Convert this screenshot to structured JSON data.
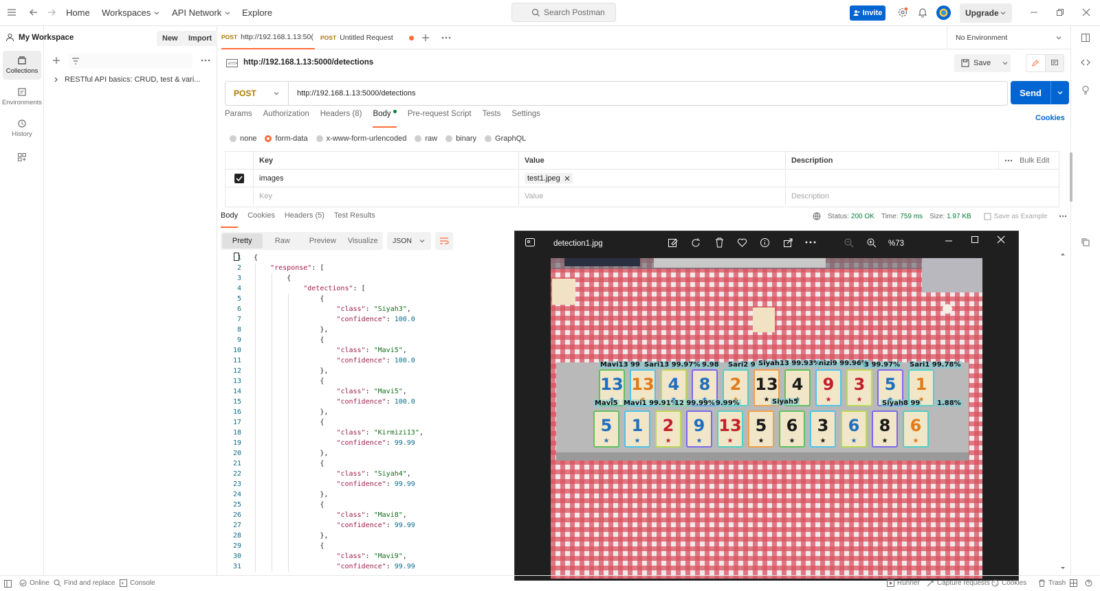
{
  "topbar": {
    "home": "Home",
    "workspaces": "Workspaces",
    "api_network": "API Network",
    "explore": "Explore",
    "search_placeholder": "Search Postman",
    "invite": "Invite",
    "upgrade": "Upgrade"
  },
  "rail": {
    "collections": "Collections",
    "environments": "Environments",
    "history": "History"
  },
  "sidebar": {
    "workspace": "My Workspace",
    "new": "New",
    "import": "Import",
    "collection_item": "RESTful API basics: CRUD, test & vari..."
  },
  "tabs": [
    {
      "method": "POST",
      "label": "http://192.168.1.13:50("
    },
    {
      "method": "POST",
      "label": "Untitled Request"
    }
  ],
  "environment": "No Environment",
  "request": {
    "breadcrumb_url": "http://192.168.1.13:5000/detections",
    "save": "Save",
    "method": "POST",
    "url": "http://192.168.1.13:5000/detections",
    "send": "Send",
    "cookies": "Cookies",
    "subtabs": [
      "Params",
      "Authorization",
      "Headers (8)",
      "Body",
      "Pre-request Script",
      "Tests",
      "Settings"
    ],
    "body_types": [
      "none",
      "form-data",
      "x-www-form-urlencoded",
      "raw",
      "binary",
      "GraphQL"
    ]
  },
  "params_table": {
    "headers": {
      "key": "Key",
      "value": "Value",
      "description": "Description",
      "bulk_edit": "Bulk Edit"
    },
    "row": {
      "key": "images",
      "value": "test1.jpeg"
    },
    "placeholder": {
      "key": "Key",
      "value": "Value",
      "description": "Description"
    }
  },
  "response": {
    "tabs": [
      "Body",
      "Cookies",
      "Headers (5)",
      "Test Results"
    ],
    "status_label": "Status:",
    "status_value": "200 OK",
    "time_label": "Time:",
    "time_value": "759 ms",
    "size_label": "Size:",
    "size_value": "1.97 KB",
    "save_example": "Save as Example",
    "views": [
      "Pretty",
      "Raw",
      "Preview",
      "Visualize"
    ],
    "format": "JSON"
  },
  "code_lines": [
    {
      "n": "1",
      "t": "{"
    },
    {
      "n": "2",
      "t": "    \"response\": ["
    },
    {
      "n": "3",
      "t": "        {"
    },
    {
      "n": "4",
      "t": "            \"detections\": ["
    },
    {
      "n": "5",
      "t": "                {"
    },
    {
      "n": "6",
      "t": "                    \"class\": \"Siyah3\","
    },
    {
      "n": "7",
      "t": "                    \"confidence\": 100.0"
    },
    {
      "n": "8",
      "t": "                },"
    },
    {
      "n": "9",
      "t": "                {"
    },
    {
      "n": "10",
      "t": "                    \"class\": \"Mavi5\","
    },
    {
      "n": "11",
      "t": "                    \"confidence\": 100.0"
    },
    {
      "n": "12",
      "t": "                },"
    },
    {
      "n": "13",
      "t": "                {"
    },
    {
      "n": "14",
      "t": "                    \"class\": \"Mavi5\","
    },
    {
      "n": "15",
      "t": "                    \"confidence\": 100.0"
    },
    {
      "n": "16",
      "t": "                },"
    },
    {
      "n": "17",
      "t": "                {"
    },
    {
      "n": "18",
      "t": "                    \"class\": \"Kirmizi13\","
    },
    {
      "n": "19",
      "t": "                    \"confidence\": 99.99"
    },
    {
      "n": "20",
      "t": "                },"
    },
    {
      "n": "21",
      "t": "                {"
    },
    {
      "n": "22",
      "t": "                    \"class\": \"Siyah4\","
    },
    {
      "n": "23",
      "t": "                    \"confidence\": 99.99"
    },
    {
      "n": "24",
      "t": "                },"
    },
    {
      "n": "25",
      "t": "                {"
    },
    {
      "n": "26",
      "t": "                    \"class\": \"Mavi8\","
    },
    {
      "n": "27",
      "t": "                    \"confidence\": 99.99"
    },
    {
      "n": "28",
      "t": "                },"
    },
    {
      "n": "29",
      "t": "                {"
    },
    {
      "n": "30",
      "t": "                    \"class\": \"Mavi9\","
    },
    {
      "n": "31",
      "t": "                    \"confidence\": 99.99"
    }
  ],
  "viewer": {
    "filename": "detection1.jpg",
    "zoom": "%73",
    "detection_labels": [
      "Mavi13 99",
      "Sari13 99.97%",
      "9.98",
      "Sari2 9",
      "Siyah13 99.93%",
      "nizi9 99.96%",
      "3 99.97%",
      "Sari1 99.78%",
      "Mavi5",
      "Mavi1 99.91%",
      "12 99.99%",
      "9.99%",
      "Siyah5",
      "Siyah8 99",
      "1.88%"
    ],
    "tiles_top": [
      "13",
      "13",
      "4",
      "8",
      "2",
      "13",
      "4",
      "9",
      "3",
      "5",
      "1"
    ],
    "tiles_bottom": [
      "5",
      "1",
      "2",
      "9",
      "13",
      "5",
      "6",
      "3",
      "6",
      "8",
      "6"
    ]
  },
  "statusbar": {
    "online": "Online",
    "find_replace": "Find and replace",
    "console": "Console",
    "runner": "Runner",
    "capture": "Capture requests",
    "cookies": "Cookies",
    "trash": "Trash"
  },
  "colors": {
    "brand_orange": "#ff6c37",
    "send_blue": "#0265d2",
    "method_post": "#ad7a03",
    "status_green": "#007f31"
  }
}
